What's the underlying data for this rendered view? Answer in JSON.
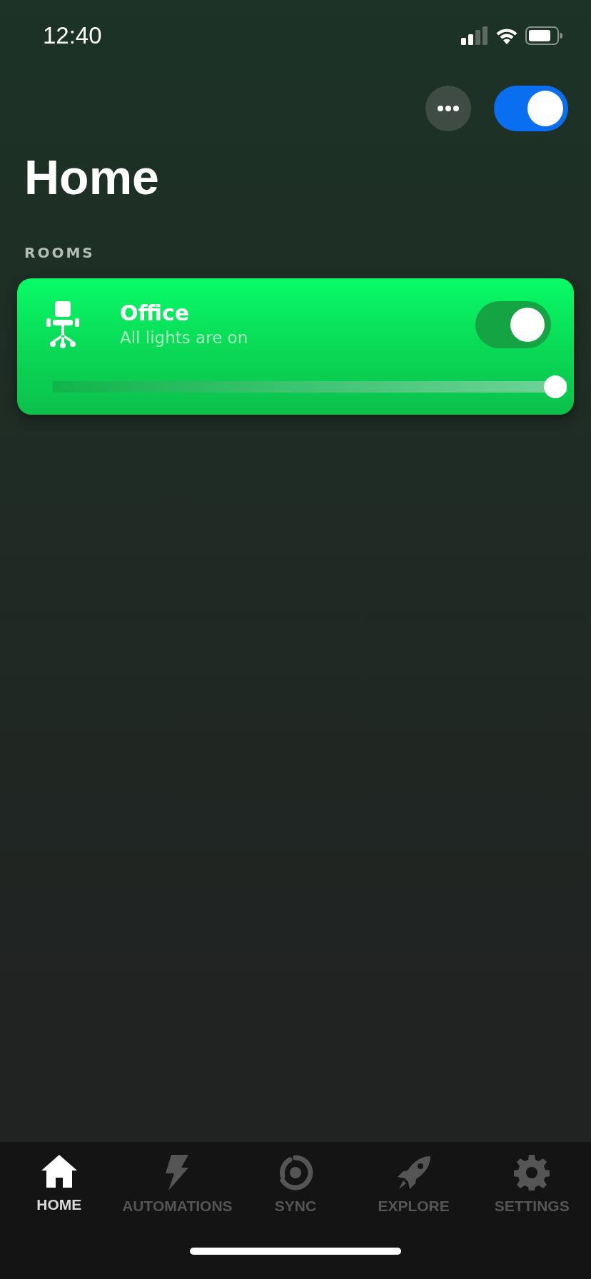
{
  "status_bar": {
    "time": "12:40"
  },
  "header": {
    "all_lights_on": true,
    "title": "Home"
  },
  "rooms_heading": "ROOMS",
  "rooms": [
    {
      "name": "Office",
      "status": "All lights are on",
      "on": true,
      "level": 1
    }
  ],
  "tabs": [
    {
      "kind": "home",
      "label": "HOME",
      "selected": true
    },
    {
      "kind": "automations",
      "label": "AUTOMATIONS",
      "selected": false
    },
    {
      "kind": "sync",
      "label": "SYNC",
      "selected": false
    },
    {
      "kind": "explore",
      "label": "EXPLORE",
      "selected": false
    },
    {
      "kind": "settings",
      "label": "SETTINGS",
      "selected": false
    }
  ]
}
